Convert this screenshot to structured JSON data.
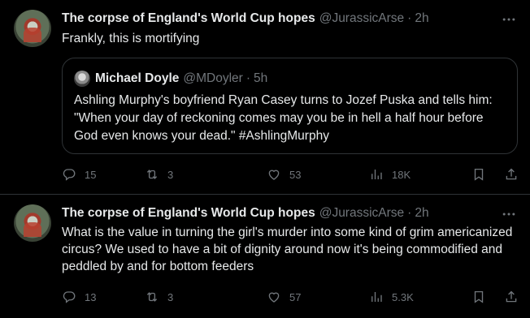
{
  "tweets": [
    {
      "author_name": "The corpse of England's World Cup hopes",
      "handle": "@JurassicArse",
      "separator": "·",
      "time": "2h",
      "text": "Frankly, this is mortifying",
      "quote": {
        "author_name": "Michael Doyle",
        "handle": "@MDoyler",
        "separator": "·",
        "time": "5h",
        "text": "Ashling Murphy's boyfriend Ryan Casey turns to Jozef Puska and tells him: \"When your day of reckoning comes may you be in hell a half hour before God even knows your dead.\" #AshlingMurphy"
      },
      "replies": "15",
      "reposts": "3",
      "likes": "53",
      "views": "18K"
    },
    {
      "author_name": "The corpse of England's World Cup hopes",
      "handle": "@JurassicArse",
      "separator": "·",
      "time": "2h",
      "text": "What is the value in turning the girl's murder into some kind of grim americanized circus? We used to have a bit of dignity around now it's being commodified and peddled by and for bottom feeders",
      "replies": "13",
      "reposts": "3",
      "likes": "57",
      "views": "5.3K"
    }
  ],
  "icons": {
    "reply": "reply-icon",
    "repost": "repost-icon",
    "like": "like-icon",
    "views": "views-icon",
    "bookmark": "bookmark-icon",
    "share": "share-icon",
    "more": "more-icon"
  },
  "colors": {
    "background": "#000000",
    "primary_text": "#e7e9ea",
    "secondary_text": "#71767b",
    "border": "#2f3336"
  }
}
